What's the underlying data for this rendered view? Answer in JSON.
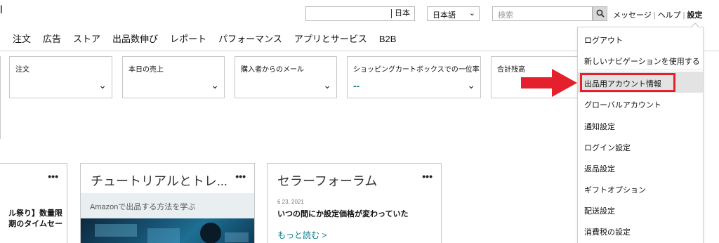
{
  "header": {
    "logo_fragment": "l",
    "marketplace": "日本",
    "language": "日本語",
    "search_placeholder": "検索",
    "links": [
      "メッセージ",
      "ヘルプ",
      "設定"
    ],
    "active_link": "設定"
  },
  "nav": {
    "items": [
      "注文",
      "広告",
      "ストア",
      "出品数伸び",
      "レポート",
      "パフォーマンス",
      "アプリとサービス",
      "B2B"
    ]
  },
  "widgets": [
    {
      "title": "注文",
      "value": ""
    },
    {
      "title": "本日の売上",
      "value": ""
    },
    {
      "title": "購入者からのメール",
      "value": ""
    },
    {
      "title": "ショッピングカートボックスでの一位率",
      "value": "--"
    },
    {
      "title": "合計残高",
      "value": ""
    }
  ],
  "cards": [
    {
      "title": "",
      "lines": [
        "ル祭り】数量限",
        "期のタイムセー"
      ]
    },
    {
      "title": "チュートリアルとトレ...",
      "subtitle": "Amazonで出品する方法を学ぶ"
    },
    {
      "title": "セラーフォーラム",
      "date": "6 23, 2021",
      "post": "いつの間にか設定価格が変わっていた",
      "more": "もっと読む >"
    }
  ],
  "dropdown": {
    "items": [
      "ログアウト",
      "新しいナビゲーションを使用する",
      "出品用アカウント情報",
      "グローバルアカウント",
      "通知設定",
      "ログイン設定",
      "返品設定",
      "ギフトオプション",
      "配送設定",
      "消費税の設定"
    ],
    "highlighted_index": 2
  },
  "colors": {
    "annotation_red": "#e3202b",
    "link_teal": "#0a7c8c",
    "metric_teal": "#08857a"
  }
}
